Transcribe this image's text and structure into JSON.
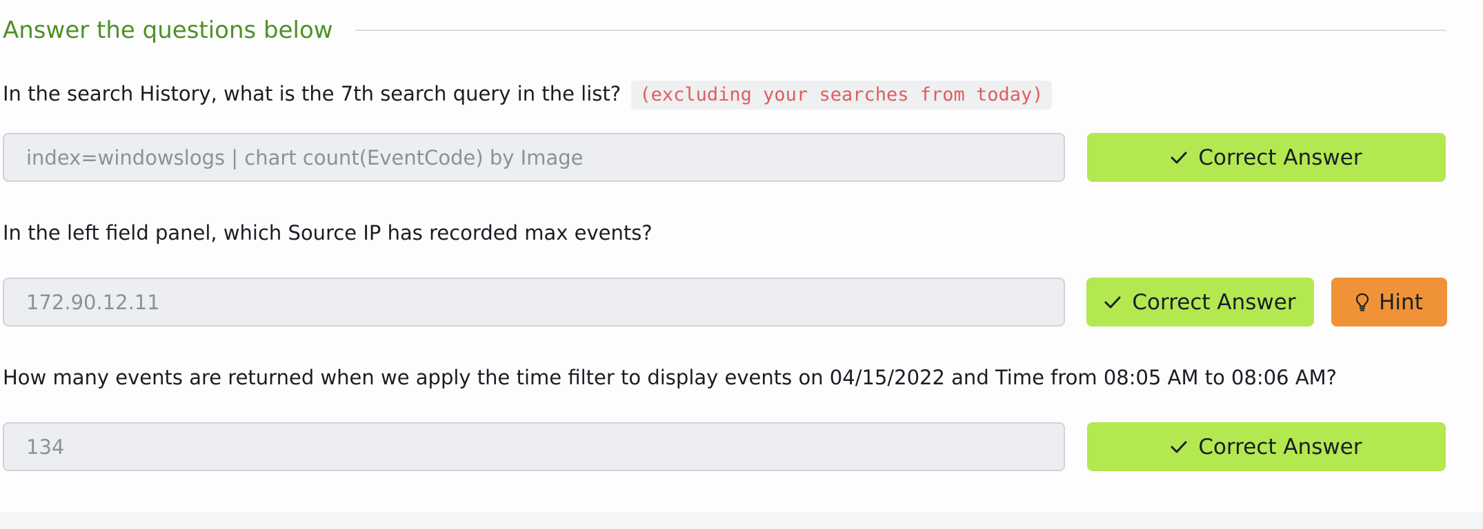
{
  "section": {
    "title": "Answer the questions below"
  },
  "questions": [
    {
      "text": "In the search History, what is the 7th search query in the list?",
      "code_note": "(excluding your searches from today)",
      "answer": "index=windowslogs | chart count(EventCode) by Image",
      "button_label": "Correct Answer"
    },
    {
      "text": "In the left field panel, which Source IP has recorded max events?",
      "answer": "172.90.12.11",
      "button_label": "Correct Answer",
      "hint_label": "Hint"
    },
    {
      "text": "How many events are returned when we apply the time filter to display events on 04/15/2022 and Time from 08:05 AM to 08:06 AM?",
      "answer": "134",
      "button_label": "Correct Answer"
    }
  ],
  "colors": {
    "title_green": "#4f9027",
    "correct_button": "#b3e851",
    "hint_button": "#f09237",
    "code_text": "#e25c5c"
  },
  "icons": {
    "correct": "check-icon",
    "hint": "lightbulb-icon"
  }
}
